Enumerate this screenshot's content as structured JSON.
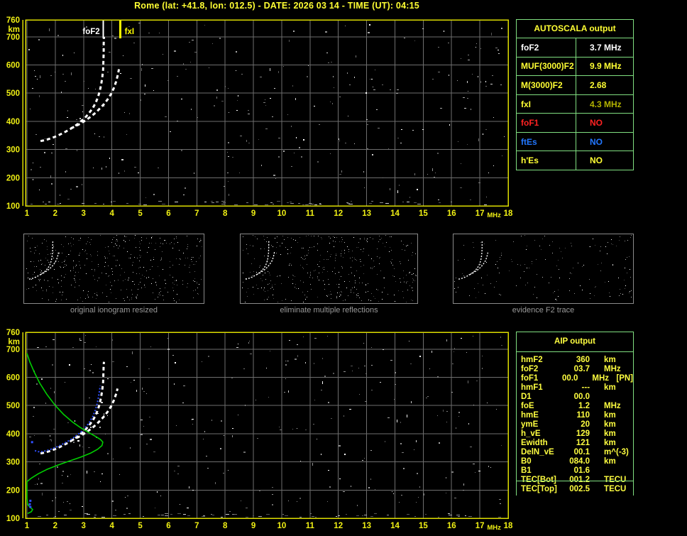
{
  "window": {
    "title": "Rome (lat: +41.8, lon: 012.5) - DATE: 2026 03 14 - TIME (UT): 04:15"
  },
  "colors": {
    "background": "#000000",
    "axis_border": "#dcdc00",
    "tick_text": "#f0f014",
    "grid": "#6e6e6e",
    "title_text": "#ffff33",
    "trace_white": "#ffffff",
    "trace_blue": "#3050ff",
    "profile_green": "#00d000",
    "table_border_green": "#80df80",
    "caption_gray": "#9a9a9a",
    "thumb_border": "#8a8a8a",
    "text_white": "#ffffff",
    "text_yellow": "#ffff33",
    "text_olive": "#b2b200",
    "text_red": "#ff2222",
    "text_blue": "#2277ff"
  },
  "autoscala_table": {
    "title": "AUTOSCALA output",
    "rows": [
      {
        "label": "foF2",
        "value": "3.7 MHz",
        "color": "white"
      },
      {
        "label": "MUF(3000)F2",
        "value": "9.9 MHz",
        "color": "yellow"
      },
      {
        "label": "M(3000)F2",
        "value": "2.68",
        "color": "yellow"
      },
      {
        "label": "fxI",
        "value": "4.3 MHz",
        "color": "yellow",
        "value_color": "olive"
      },
      {
        "label": "foF1",
        "value": "NO",
        "color": "red"
      },
      {
        "label": "ftEs",
        "value": "NO",
        "color": "blue"
      },
      {
        "label": "h'Es",
        "value": "NO",
        "color": "yellow"
      }
    ]
  },
  "aip_table": {
    "title": "AIP output",
    "rows": [
      {
        "label": "hmF2",
        "value": "360",
        "unit": "km",
        "extra": ""
      },
      {
        "label": "foF2",
        "value": "03.7",
        "unit": "MHz",
        "extra": ""
      },
      {
        "label": "foF1",
        "value": "00.0",
        "unit": "MHz",
        "extra": "[PN]"
      },
      {
        "label": "hmF1",
        "value": "---",
        "unit": "km",
        "extra": ""
      },
      {
        "label": "D1",
        "value": "00.0",
        "unit": "",
        "extra": ""
      },
      {
        "label": "foE",
        "value": "1.2",
        "unit": "MHz",
        "extra": ""
      },
      {
        "label": "hmE",
        "value": "110",
        "unit": "km",
        "extra": ""
      },
      {
        "label": "ymE",
        "value": "20",
        "unit": "km",
        "extra": ""
      },
      {
        "label": "h_vE",
        "value": "129",
        "unit": "km",
        "extra": ""
      },
      {
        "label": "Ewidth",
        "value": "121",
        "unit": "km",
        "extra": ""
      },
      {
        "label": "DelN_vE",
        "value": "00.1",
        "unit": "m^(-3)",
        "extra": ""
      },
      {
        "label": "B0",
        "value": "084.0",
        "unit": "km",
        "extra": ""
      },
      {
        "label": "B1",
        "value": "01.6",
        "unit": "",
        "extra": ""
      },
      {
        "label": "TEC[Bot]",
        "value": "001.2",
        "unit": "TECU",
        "extra": ""
      },
      {
        "label": "TEC[Top]",
        "value": "002.5",
        "unit": "TECU",
        "extra": ""
      }
    ]
  },
  "thumbnails": [
    {
      "caption": "original ionogram resized",
      "noise_count": 420,
      "seed": 101
    },
    {
      "caption": "eliminate multiple reflections",
      "noise_count": 400,
      "seed": 202
    },
    {
      "caption": "evidence F2 trace",
      "noise_count": 160,
      "seed": 303
    }
  ],
  "chart_data": [
    {
      "type": "scatter",
      "name": "autoscaled-ionogram",
      "title": "autoscaled ionogram with foF2 / fxI markers",
      "xlabel": "MHz",
      "ylabel": "km",
      "xlim": [
        1,
        18
      ],
      "ylim": [
        100,
        760
      ],
      "xticks": [
        1,
        2,
        3,
        4,
        5,
        6,
        7,
        8,
        9,
        10,
        11,
        12,
        13,
        14,
        15,
        16,
        17,
        18
      ],
      "yticks": [
        760,
        700,
        600,
        500,
        400,
        300,
        200,
        100
      ],
      "grid": true,
      "legend": "none",
      "markers": [
        {
          "name": "foF2",
          "f": 3.7,
          "color": "#ffffff",
          "label_side": "left"
        },
        {
          "name": "fxI",
          "f": 4.3,
          "color": "#ffff00",
          "label_side": "right"
        }
      ],
      "series": [
        {
          "name": "O-mode echo trace",
          "style": "dashed",
          "color": "#ffffff",
          "points": [
            [
              1.48,
              330
            ],
            [
              1.58,
              332
            ],
            [
              1.7,
              335
            ],
            [
              1.83,
              339
            ],
            [
              1.96,
              344
            ],
            [
              2.1,
              350
            ],
            [
              2.24,
              357
            ],
            [
              2.38,
              364
            ],
            [
              2.52,
              372
            ],
            [
              2.66,
              381
            ],
            [
              2.8,
              391
            ],
            [
              2.94,
              403
            ],
            [
              3.08,
              416
            ],
            [
              3.2,
              430
            ],
            [
              3.32,
              446
            ],
            [
              3.42,
              464
            ],
            [
              3.5,
              484
            ],
            [
              3.57,
              506
            ],
            [
              3.62,
              530
            ],
            [
              3.66,
              556
            ],
            [
              3.69,
              584
            ],
            [
              3.7,
              614
            ],
            [
              3.71,
              645
            ],
            [
              3.71,
              675
            ],
            [
              3.72,
              700
            ]
          ]
        },
        {
          "name": "X-mode echo trace",
          "style": "dashed",
          "color": "#ffffff",
          "points": [
            [
              2.55,
              375
            ],
            [
              2.7,
              382
            ],
            [
              2.85,
              390
            ],
            [
              3.0,
              399
            ],
            [
              3.15,
              409
            ],
            [
              3.3,
              420
            ],
            [
              3.44,
              432
            ],
            [
              3.58,
              446
            ],
            [
              3.72,
              461
            ],
            [
              3.85,
              478
            ],
            [
              3.97,
              497
            ],
            [
              4.07,
              518
            ],
            [
              4.15,
              541
            ],
            [
              4.21,
              565
            ],
            [
              4.25,
              585
            ]
          ]
        }
      ],
      "noise": {
        "seed": 11,
        "count": 290
      }
    },
    {
      "type": "scatter",
      "name": "profile-ionogram",
      "title": "ionogram with autoscaled trace and electron density profile",
      "xlabel": "MHz",
      "ylabel": "km",
      "xlim": [
        1,
        18
      ],
      "ylim": [
        100,
        760
      ],
      "xticks": [
        1,
        2,
        3,
        4,
        5,
        6,
        7,
        8,
        9,
        10,
        11,
        12,
        13,
        14,
        15,
        16,
        17,
        18
      ],
      "yticks": [
        760,
        700,
        600,
        500,
        400,
        300,
        200,
        100
      ],
      "grid": true,
      "legend": "none",
      "markers": [],
      "series": [
        {
          "name": "O-mode echo trace",
          "style": "dashed",
          "color": "#ffffff",
          "points": [
            [
              1.48,
              330
            ],
            [
              1.58,
              332
            ],
            [
              1.7,
              335
            ],
            [
              1.83,
              339
            ],
            [
              1.96,
              344
            ],
            [
              2.1,
              350
            ],
            [
              2.24,
              357
            ],
            [
              2.38,
              364
            ],
            [
              2.52,
              372
            ],
            [
              2.66,
              381
            ],
            [
              2.8,
              391
            ],
            [
              2.94,
              403
            ],
            [
              3.08,
              416
            ],
            [
              3.2,
              430
            ],
            [
              3.32,
              446
            ],
            [
              3.42,
              464
            ],
            [
              3.5,
              484
            ],
            [
              3.57,
              506
            ],
            [
              3.62,
              530
            ],
            [
              3.66,
              556
            ],
            [
              3.69,
              584
            ],
            [
              3.7,
              614
            ],
            [
              3.71,
              645
            ],
            [
              3.72,
              655
            ]
          ]
        },
        {
          "name": "X-mode echo trace",
          "style": "dashed",
          "color": "#ffffff",
          "points": [
            [
              2.55,
              375
            ],
            [
              2.7,
              382
            ],
            [
              2.85,
              390
            ],
            [
              3.0,
              399
            ],
            [
              3.15,
              409
            ],
            [
              3.3,
              420
            ],
            [
              3.44,
              432
            ],
            [
              3.58,
              446
            ],
            [
              3.72,
              461
            ],
            [
              3.85,
              478
            ],
            [
              3.97,
              497
            ],
            [
              4.07,
              518
            ],
            [
              4.15,
              541
            ],
            [
              4.2,
              560
            ]
          ]
        },
        {
          "name": "scaled F2 trace",
          "style": "dotted",
          "color": "#3050ff",
          "points": [
            [
              1.28,
              340
            ],
            [
              1.38,
              336
            ],
            [
              1.52,
              336
            ],
            [
              1.66,
              339
            ],
            [
              1.82,
              344
            ],
            [
              1.98,
              350
            ],
            [
              2.14,
              357
            ],
            [
              2.3,
              365
            ],
            [
              2.46,
              374
            ],
            [
              2.62,
              384
            ],
            [
              2.78,
              396
            ],
            [
              2.94,
              409
            ],
            [
              3.08,
              424
            ],
            [
              3.21,
              441
            ],
            [
              3.32,
              460
            ],
            [
              3.41,
              482
            ],
            [
              3.48,
              506
            ],
            [
              3.53,
              532
            ],
            [
              3.57,
              558
            ],
            [
              3.59,
              570
            ]
          ]
        },
        {
          "name": "electron density profile",
          "style": "line",
          "color": "#00d000",
          "points": [
            [
              1.0,
              685
            ],
            [
              1.1,
              655
            ],
            [
              1.25,
              620
            ],
            [
              1.45,
              580
            ],
            [
              1.7,
              540
            ],
            [
              2.0,
              500
            ],
            [
              2.3,
              468
            ],
            [
              2.6,
              442
            ],
            [
              2.9,
              421
            ],
            [
              3.2,
              403
            ],
            [
              3.45,
              389
            ],
            [
              3.6,
              379
            ],
            [
              3.68,
              370
            ],
            [
              3.65,
              358
            ],
            [
              3.5,
              345
            ],
            [
              3.25,
              331
            ],
            [
              2.9,
              317
            ],
            [
              2.5,
              303
            ],
            [
              2.1,
              289
            ],
            [
              1.7,
              273
            ],
            [
              1.4,
              258
            ],
            [
              1.15,
              242
            ],
            [
              1.0,
              230
            ],
            [
              1.0,
              200
            ],
            [
              1.0,
              170
            ],
            [
              1.02,
              150
            ],
            [
              1.1,
              140
            ],
            [
              1.2,
              131
            ],
            [
              1.15,
              123
            ],
            [
              1.02,
              117
            ]
          ]
        },
        {
          "name": "E-region scaled points",
          "style": "dots",
          "color": "#3050ff",
          "points": [
            [
              1.18,
              370
            ],
            [
              1.12,
              162
            ],
            [
              1.1,
              150
            ],
            [
              1.12,
              140
            ]
          ]
        }
      ],
      "noise": {
        "seed": 23,
        "count": 300
      }
    }
  ]
}
